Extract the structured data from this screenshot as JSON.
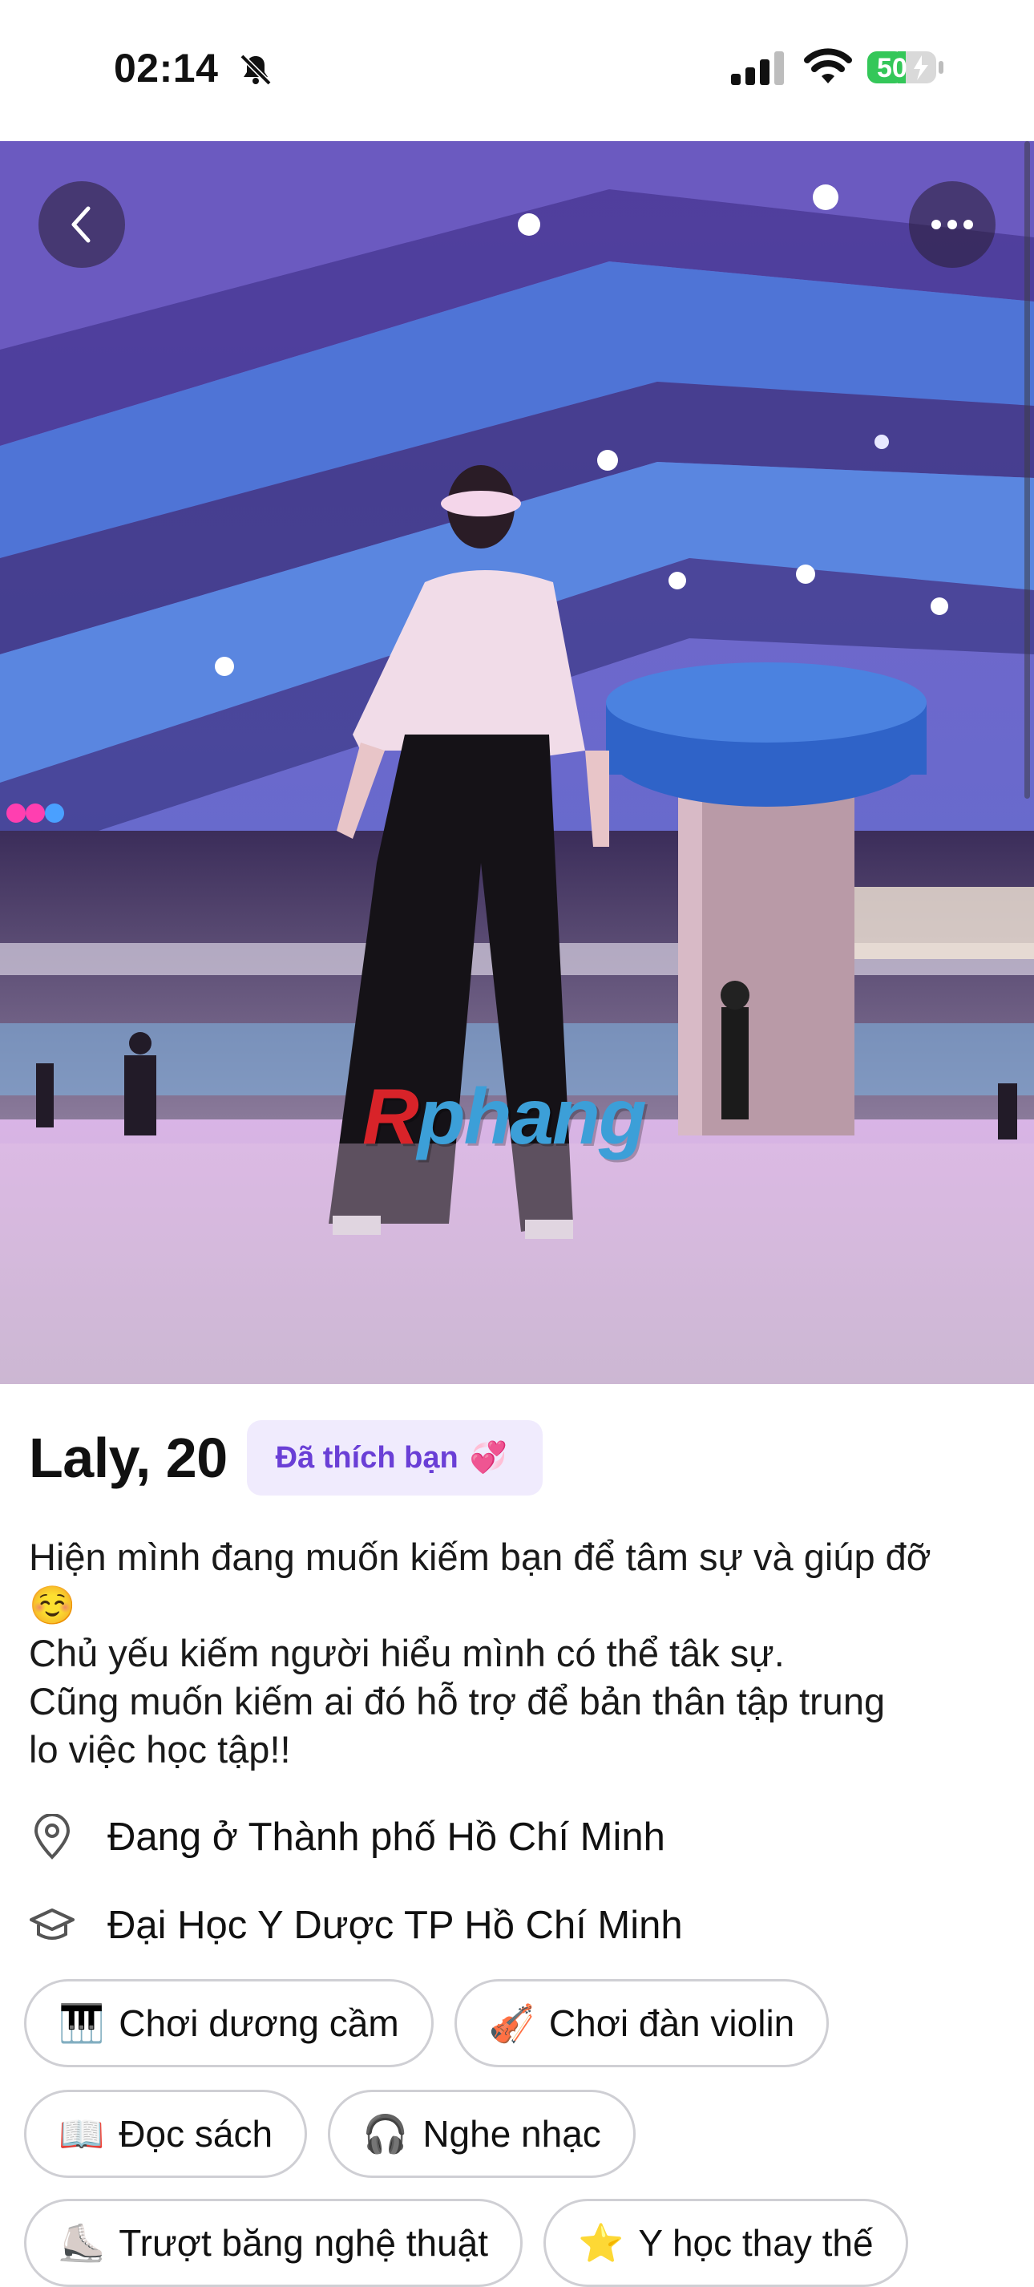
{
  "status_bar": {
    "time": "02:14",
    "battery": "50",
    "icons": [
      "bell-slash-icon",
      "signal-icon",
      "wifi-icon",
      "battery-icon"
    ]
  },
  "photo": {
    "watermark_text": "Rphang",
    "buttons": {
      "back": "chevron-left-icon",
      "more": "more-dots-icon"
    }
  },
  "profile": {
    "name_age": "Laly, 20",
    "liked_badge": {
      "label": "Đã thích bạn",
      "emoji": "💞"
    },
    "bio_lines": [
      "Hiện mình đang muốn kiếm bạn để tâm sự và giúp đỡ",
      "☺️",
      "Chủ yếu kiếm người hiểu mình có thể tâk sự.",
      "Cũng muốn kiếm ai đó hỗ trợ để bản thân tập trung",
      "lo việc học tập!!"
    ],
    "location": "Đang ở Thành phố Hồ Chí Minh",
    "school": "Đại Học Y Dược TP Hồ Chí Minh"
  },
  "interests": [
    {
      "emoji": "🎹",
      "label": "Chơi dương cầm"
    },
    {
      "emoji": "🎻",
      "label": "Chơi đàn violin"
    },
    {
      "emoji": "📖",
      "label": "Đọc sách"
    },
    {
      "emoji": "🎧",
      "label": "Nghe nhạc"
    },
    {
      "emoji": "⛸️",
      "label": "Trượt băng nghệ thuật"
    },
    {
      "emoji": "⭐",
      "label": "Y học thay thế"
    }
  ],
  "colors": {
    "badge_bg": "#f0ebfd",
    "badge_text": "#6a3fd6",
    "chip_border": "#cfcfd4",
    "battery_green": "#34c759"
  }
}
